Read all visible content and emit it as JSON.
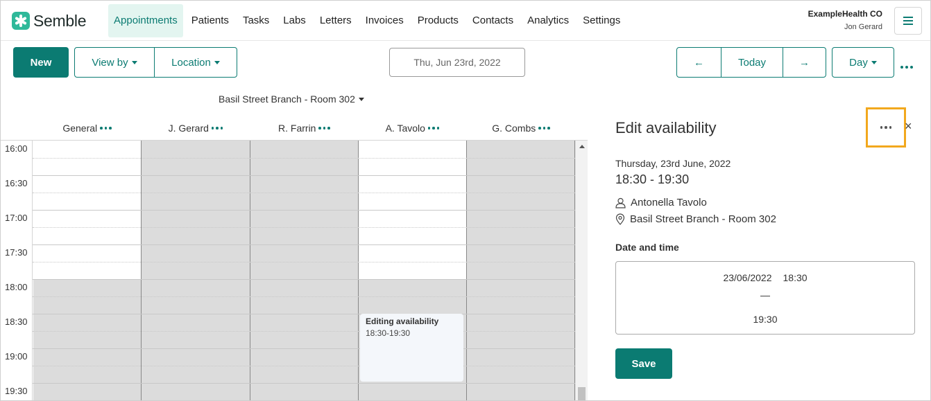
{
  "app": {
    "name": "Semble"
  },
  "nav": {
    "items": [
      "Appointments",
      "Patients",
      "Tasks",
      "Labs",
      "Letters",
      "Invoices",
      "Products",
      "Contacts",
      "Analytics",
      "Settings"
    ],
    "active": "Appointments"
  },
  "account": {
    "org": "ExampleHealth CO",
    "user": "Jon Gerard"
  },
  "toolbar": {
    "new_label": "New",
    "view_by_label": "View by",
    "location_label": "Location",
    "date": "Thu, Jun 23rd, 2022",
    "prev_label": "←",
    "today_label": "Today",
    "next_label": "→",
    "view_mode_label": "Day"
  },
  "calendar": {
    "room": "Basil Street Branch - Room 302",
    "columns": [
      "General",
      "J. Gerard",
      "R. Farrin",
      "A. Tavolo",
      "G. Combs"
    ],
    "times": [
      "16:00",
      "16:30",
      "17:00",
      "17:30",
      "18:00",
      "18:30",
      "19:00",
      "19:30"
    ],
    "event": {
      "title": "Editing availability",
      "time": "18:30-19:30"
    }
  },
  "panel": {
    "title": "Edit availability",
    "close_label": "×",
    "date": "Thursday, 23rd June, 2022",
    "time": "18:30 - 19:30",
    "person": "Antonella Tavolo",
    "location": "Basil Street Branch - Room 302",
    "section_label": "Date and time",
    "start_date": "23/06/2022",
    "start_time": "18:30",
    "separator": "—",
    "end_time": "19:30",
    "save_label": "Save"
  },
  "colors": {
    "primary": "#0b7b72",
    "highlight": "#f2a81d",
    "unavailable": "#dcdcdc",
    "active_nav_bg": "#e3f5f0"
  }
}
